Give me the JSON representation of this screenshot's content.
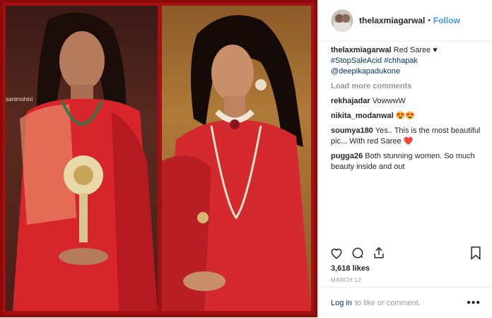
{
  "post": {
    "watermark": "sanimohini",
    "author": "thelaxmiagarwal",
    "separator": "•",
    "follow_label": "Follow",
    "caption": {
      "username": "thelaxmiagarwal",
      "text": "Red Saree ♥",
      "tags": "#StopSaleAcid #chhapak @deepikapadukone"
    },
    "load_more_label": "Load more comments",
    "comments": [
      {
        "user": "rekhajadar",
        "text": "VowwwW"
      },
      {
        "user": "nikita_modanwal",
        "text": "😍😍"
      },
      {
        "user": "soumya180",
        "text": "Yes.. This is the most beautiful pic... With red Saree ❤️"
      },
      {
        "user": "pugga26",
        "text": "Both stunning women. So much beauty inside and out"
      }
    ],
    "likes": "3,618 likes",
    "date": "MARCH 12",
    "footer": {
      "login_label": "Log in",
      "rest_text": "to like or comment.",
      "more_icon": "•••"
    }
  },
  "colors": {
    "accent": "#3897f0",
    "link": "#003569",
    "muted": "#999999",
    "frame": "#a40f12"
  }
}
